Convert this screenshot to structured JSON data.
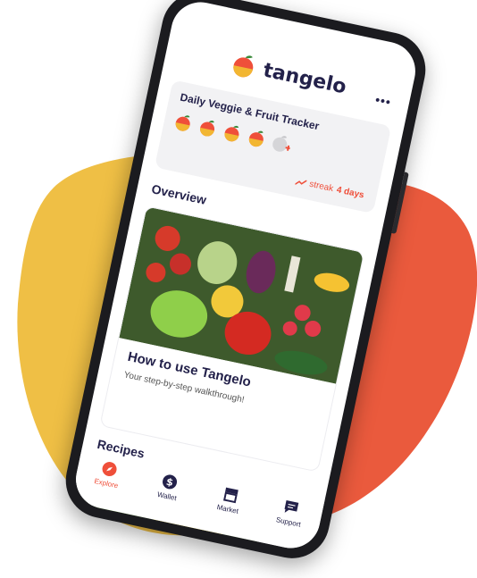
{
  "app": {
    "brand_name": "tangelo",
    "more_menu": "•••"
  },
  "tracker": {
    "title": "Daily Veggie & Fruit Tracker",
    "servings_filled": 4,
    "servings_total": 5,
    "streak_prefix": "streak",
    "streak_value": "4 days"
  },
  "overview": {
    "heading": "Overview",
    "card_title": "How to use Tangelo",
    "card_subtitle": "Your step-by-step walkthrough!"
  },
  "recipes": {
    "heading": "Recipes"
  },
  "nav": {
    "items": [
      {
        "label": "Explore",
        "icon": "compass-icon",
        "active": true
      },
      {
        "label": "Wallet",
        "icon": "dollar-icon",
        "active": false
      },
      {
        "label": "Market",
        "icon": "storefront-icon",
        "active": false
      },
      {
        "label": "Support",
        "icon": "chat-icon",
        "active": false
      }
    ]
  },
  "colors": {
    "brand_orange": "#ef4f3a",
    "brand_yellow": "#f2b632",
    "navy": "#23214a",
    "blob_yellow": "#efbf45",
    "blob_red": "#ea5a3d"
  }
}
